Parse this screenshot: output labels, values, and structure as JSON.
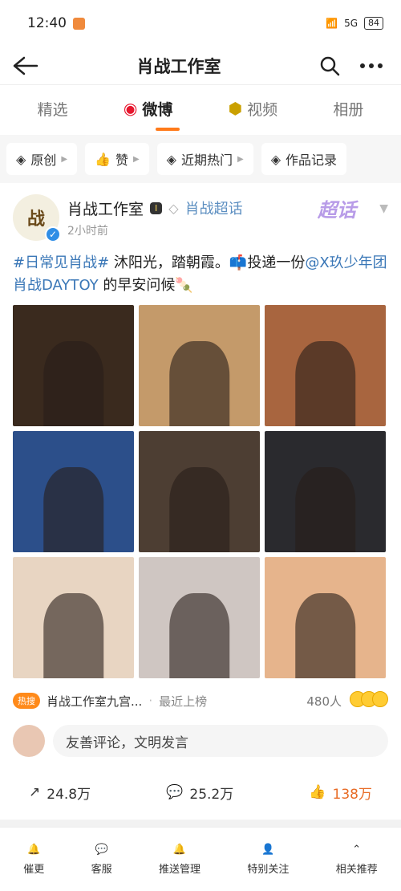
{
  "status": {
    "time": "12:40",
    "network": "5G",
    "battery": "84"
  },
  "topbar": {
    "title": "肖战工作室"
  },
  "tabs": [
    {
      "label": "精选"
    },
    {
      "label": "微博"
    },
    {
      "label": "视频"
    },
    {
      "label": "相册"
    }
  ],
  "filters": [
    {
      "label": "原创"
    },
    {
      "label": "赞"
    },
    {
      "label": "近期热门"
    },
    {
      "label": "作品记录"
    }
  ],
  "post": {
    "avatar_text": "战",
    "username": "肖战工作室",
    "level_badge": "I",
    "topic": "肖战超话",
    "supertopic_mark": "超话",
    "time": "2小时前",
    "content": {
      "hashtag": "#日常见肖战#",
      "text1": " 沐阳光，踏朝霞。",
      "text2": "投递一份",
      "mention": "@X玖少年团肖战DAYTOY",
      "text3": " 的早安问候"
    },
    "photos": [
      {
        "bg": "#3a2a1e"
      },
      {
        "bg": "#c49a6a"
      },
      {
        "bg": "#a8653f"
      },
      {
        "bg": "#2c4f8a"
      },
      {
        "bg": "#4d3e33"
      },
      {
        "bg": "#2a2a2e"
      },
      {
        "bg": "#e8d5c2"
      },
      {
        "bg": "#cfc6c2"
      },
      {
        "bg": "#e6b48c"
      }
    ],
    "hot": {
      "tag": "热搜",
      "text": "肖战工作室九宫...",
      "sub": "最近上榜",
      "count": "480人"
    },
    "comment_placeholder": "友善评论，文明发言",
    "actions": {
      "share": "24.8万",
      "comment": "25.2万",
      "like": "138万"
    }
  },
  "bottombar": [
    {
      "label": "催更"
    },
    {
      "label": "客服"
    },
    {
      "label": "推送管理"
    },
    {
      "label": "特别关注"
    },
    {
      "label": "相关推荐"
    }
  ]
}
